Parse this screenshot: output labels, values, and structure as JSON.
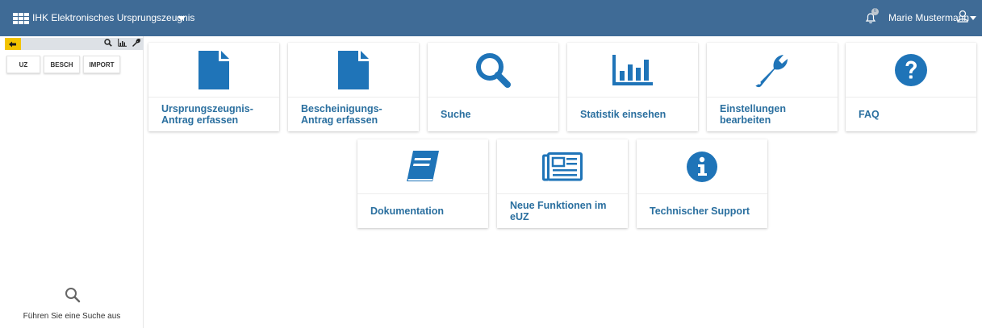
{
  "header": {
    "app_title": "IHK Elektronisches Ursprungszeugnis",
    "notification_count": "0",
    "user_name": "Marie Mustermann"
  },
  "sidebar": {
    "tabs": [
      "UZ",
      "BESCH",
      "IMPORT"
    ],
    "search_hint": "Führen Sie eine Suche aus"
  },
  "tiles": [
    {
      "label": "Ursprungszeugnis-Antrag erfassen",
      "icon": "file-icon"
    },
    {
      "label": "Bescheinigungs-Antrag erfassen",
      "icon": "file-icon"
    },
    {
      "label": "Suche",
      "icon": "search-icon"
    },
    {
      "label": "Statistik einsehen",
      "icon": "bar-chart-icon"
    },
    {
      "label": "Einstellungen bearbeiten",
      "icon": "wrench-icon"
    },
    {
      "label": "FAQ",
      "icon": "question-circle-icon"
    },
    {
      "label": "Dokumentation",
      "icon": "book-icon"
    },
    {
      "label": "Neue Funktionen im eUZ",
      "icon": "newspaper-icon"
    },
    {
      "label": "Technischer Support",
      "icon": "info-circle-icon"
    }
  ],
  "colors": {
    "header_bg": "#3f6b96",
    "accent": "#1f74b8",
    "label_text": "#2a6f9f",
    "pin_yellow": "#f2c300"
  }
}
